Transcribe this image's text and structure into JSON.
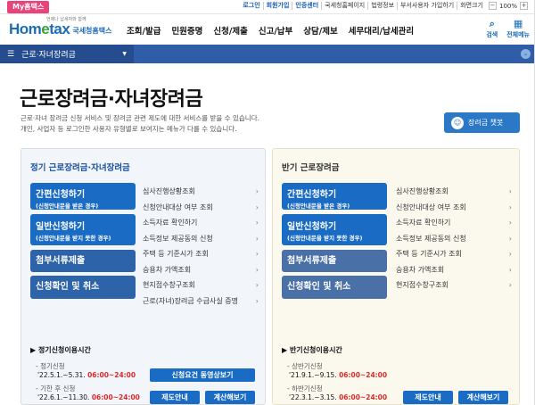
{
  "util": {
    "my_tab": "My홈택스",
    "links": [
      "로그인",
      "회원가입",
      "인증센터",
      "국세청홈페이지",
      "법령정보",
      "부서사용자 가입하기",
      "화면크기"
    ],
    "zoom_minus": "−",
    "zoom_value": "100%",
    "zoom_plus": "+"
  },
  "header": {
    "logo_text_a": "Hom",
    "logo_text_e": "e",
    "logo_text_b": "tax",
    "logo_sub": "국세청홈택스",
    "logo_tag": "언제나 납세자와 함께",
    "nav": [
      "조회/발급",
      "민원증명",
      "신청/제출",
      "신고/납부",
      "상담/제보",
      "세무대리/납세관리"
    ],
    "search_label": "검색",
    "menu_label": "전체메뉴"
  },
  "navbar": {
    "current": "근로·자녀장려금"
  },
  "page": {
    "title": "근로장려금·자녀장려금",
    "desc1": "근로·자녀 장려금 신청 서비스 및 장려금 관련 제도에 대한 서비스를 받을 수 있습니다.",
    "desc2": "개인, 사업자 등 로그인한 사용자 유형별로 보여지는 메뉴가 다를 수 있습니다.",
    "chatbot_label": "장려금 챗봇"
  },
  "left_panel": {
    "title": "정기 근로장려금·자녀장려금",
    "btn_simple": "간편신청하기",
    "btn_simple_sub": "(신청안내문을 받은 경우)",
    "btn_general": "일반신청하기",
    "btn_general_sub": "(신청안내문을 받지 못한 경우)",
    "btn_docs": "첨부서류제출",
    "btn_confirm": "신청확인 및 취소",
    "links": [
      "심사진행상황조회",
      "신청안내대상 여부 조회",
      "소득자료 확인하기",
      "소득정보 제공동의 신청",
      "주택 등 기준시가 조회",
      "승용차 가액조회",
      "현지접수창구조회",
      "근로(자녀)장려금 수급사실 증명"
    ],
    "period_title": "▶ 정기신청이용시간",
    "p1_label": "- 정기신청",
    "p1_dates": "'22.5.1.~5.31.",
    "p1_time": "06:00~24:00",
    "p2_label": "- 기한 후 신청",
    "p2_dates": "'22.6.1.~11.30.",
    "p2_time": "06:00~24:00",
    "video_btn": "신청요건 동영상보기",
    "guide_btn": "제도안내",
    "calc_btn": "계산해보기"
  },
  "right_panel": {
    "title": "반기 근로장려금",
    "btn_simple": "간편신청하기",
    "btn_simple_sub": "(신청안내문을 받은 경우)",
    "btn_general": "일반신청하기",
    "btn_general_sub": "(신청안내문을 받지 못한 경우)",
    "btn_docs": "첨부서류제출",
    "btn_confirm": "신청확인 및 취소",
    "links": [
      "심사진행상황조회",
      "신청안내대상 여부 조회",
      "소득자료 확인하기",
      "소득정보 제공동의 신청",
      "주택 등 기준시가 조회",
      "승용차 가액조회",
      "현지접수창구조회"
    ],
    "period_title": "▶ 반기신청이용시간",
    "p1_label": "- 상반기신청",
    "p1_dates": "'21.9.1.~9.15.",
    "p1_time": "06:00~24:00",
    "p2_label": "- 하반기신청",
    "p2_dates": "'22.3.1.~3.15.",
    "p2_time": "06:00~24:00",
    "guide_btn": "제도안내",
    "calc_btn": "계산해보기"
  }
}
